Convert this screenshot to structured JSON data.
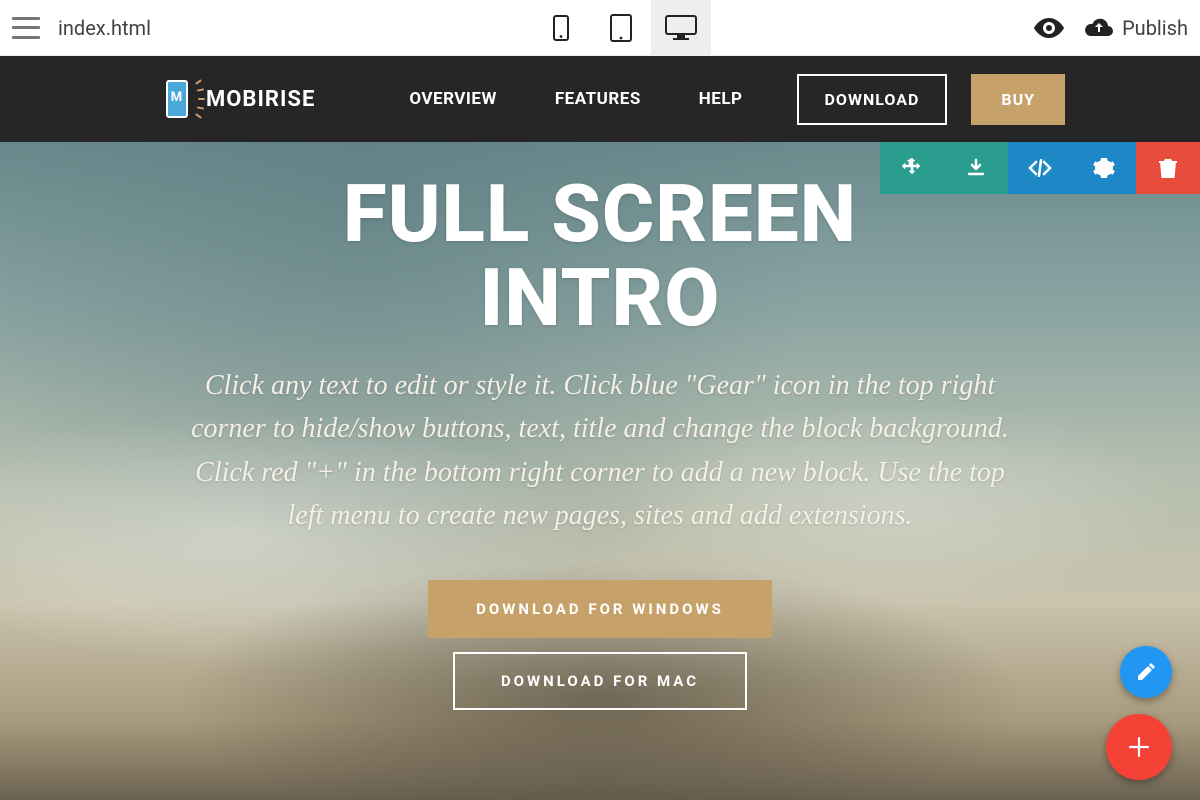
{
  "app": {
    "filename": "index.html",
    "publish_label": "Publish"
  },
  "site_nav": {
    "brand": "MOBIRISE",
    "links": [
      "OVERVIEW",
      "FEATURES",
      "HELP"
    ],
    "download_label": "DOWNLOAD",
    "buy_label": "BUY"
  },
  "hero": {
    "title_line1": "FULL SCREEN",
    "title_line2": "INTRO",
    "subtitle": "Click any text to edit or style it. Click blue \"Gear\" icon in the top right corner to hide/show buttons, text, title and change the block background. Click red \"+\" in the bottom right corner to add a new block. Use the top left menu to create new pages, sites and add extensions.",
    "cta_primary": "DOWNLOAD FOR WINDOWS",
    "cta_secondary": "DOWNLOAD FOR MAC"
  },
  "icons": {
    "menu": "menu-icon",
    "phone": "phone-icon",
    "tablet": "tablet-icon",
    "desktop": "desktop-icon",
    "preview": "eye-icon",
    "upload": "cloud-upload-icon",
    "move": "move-icon",
    "download": "download-icon",
    "code": "code-icon",
    "gear": "gear-icon",
    "trash": "trash-icon",
    "pencil": "pencil-icon",
    "plus": "plus-icon"
  },
  "colors": {
    "accent": "#c6a26a",
    "toolbar_teal": "#2a9d8f",
    "toolbar_blue": "#1e88c7",
    "toolbar_red": "#e84c3d",
    "fab_blue": "#2196f3",
    "fab_red": "#f44336"
  }
}
